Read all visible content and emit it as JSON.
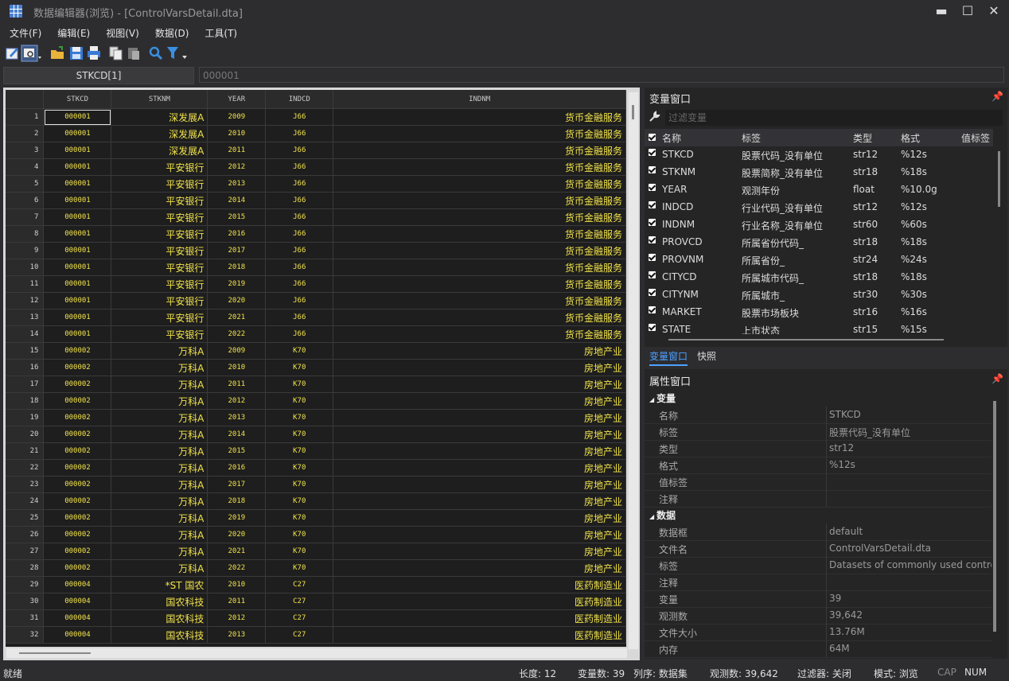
{
  "window": {
    "title": "数据编辑器(浏览) - [ControlVarsDetail.dta]",
    "min_glyph": "▬",
    "max_glyph": "☐",
    "close_glyph": "✕"
  },
  "menu": [
    "文件(F)",
    "编辑(E)",
    "视图(V)",
    "数据(D)",
    "工具(T)"
  ],
  "cellbar": {
    "name": "STKCD[1]",
    "value": "000001"
  },
  "grid": {
    "columns": [
      "STKCD",
      "STKNM",
      "YEAR",
      "INDCD",
      "INDNM"
    ],
    "rows": [
      [
        "1",
        "000001",
        "深发展A",
        "2009",
        "J66",
        "货币金融服务"
      ],
      [
        "2",
        "000001",
        "深发展A",
        "2010",
        "J66",
        "货币金融服务"
      ],
      [
        "3",
        "000001",
        "深发展A",
        "2011",
        "J66",
        "货币金融服务"
      ],
      [
        "4",
        "000001",
        "平安银行",
        "2012",
        "J66",
        "货币金融服务"
      ],
      [
        "5",
        "000001",
        "平安银行",
        "2013",
        "J66",
        "货币金融服务"
      ],
      [
        "6",
        "000001",
        "平安银行",
        "2014",
        "J66",
        "货币金融服务"
      ],
      [
        "7",
        "000001",
        "平安银行",
        "2015",
        "J66",
        "货币金融服务"
      ],
      [
        "8",
        "000001",
        "平安银行",
        "2016",
        "J66",
        "货币金融服务"
      ],
      [
        "9",
        "000001",
        "平安银行",
        "2017",
        "J66",
        "货币金融服务"
      ],
      [
        "10",
        "000001",
        "平安银行",
        "2018",
        "J66",
        "货币金融服务"
      ],
      [
        "11",
        "000001",
        "平安银行",
        "2019",
        "J66",
        "货币金融服务"
      ],
      [
        "12",
        "000001",
        "平安银行",
        "2020",
        "J66",
        "货币金融服务"
      ],
      [
        "13",
        "000001",
        "平安银行",
        "2021",
        "J66",
        "货币金融服务"
      ],
      [
        "14",
        "000001",
        "平安银行",
        "2022",
        "J66",
        "货币金融服务"
      ],
      [
        "15",
        "000002",
        "万科A",
        "2009",
        "K70",
        "房地产业"
      ],
      [
        "16",
        "000002",
        "万科A",
        "2010",
        "K70",
        "房地产业"
      ],
      [
        "17",
        "000002",
        "万科A",
        "2011",
        "K70",
        "房地产业"
      ],
      [
        "18",
        "000002",
        "万科A",
        "2012",
        "K70",
        "房地产业"
      ],
      [
        "19",
        "000002",
        "万科A",
        "2013",
        "K70",
        "房地产业"
      ],
      [
        "20",
        "000002",
        "万科A",
        "2014",
        "K70",
        "房地产业"
      ],
      [
        "21",
        "000002",
        "万科A",
        "2015",
        "K70",
        "房地产业"
      ],
      [
        "22",
        "000002",
        "万科A",
        "2016",
        "K70",
        "房地产业"
      ],
      [
        "23",
        "000002",
        "万科A",
        "2017",
        "K70",
        "房地产业"
      ],
      [
        "24",
        "000002",
        "万科A",
        "2018",
        "K70",
        "房地产业"
      ],
      [
        "25",
        "000002",
        "万科A",
        "2019",
        "K70",
        "房地产业"
      ],
      [
        "26",
        "000002",
        "万科A",
        "2020",
        "K70",
        "房地产业"
      ],
      [
        "27",
        "000002",
        "万科A",
        "2021",
        "K70",
        "房地产业"
      ],
      [
        "28",
        "000002",
        "万科A",
        "2022",
        "K70",
        "房地产业"
      ],
      [
        "29",
        "000004",
        "*ST 国农",
        "2010",
        "C27",
        "医药制造业"
      ],
      [
        "30",
        "000004",
        "国农科技",
        "2011",
        "C27",
        "医药制造业"
      ],
      [
        "31",
        "000004",
        "国农科技",
        "2012",
        "C27",
        "医药制造业"
      ],
      [
        "32",
        "000004",
        "国农科技",
        "2013",
        "C27",
        "医药制造业"
      ]
    ]
  },
  "variables_panel": {
    "title": "变量窗口",
    "filter_placeholder": "过滤变量",
    "headers": [
      "名称",
      "标签",
      "类型",
      "格式",
      "值标签"
    ],
    "rows": [
      [
        "STKCD",
        "股票代码_没有单位",
        "str12",
        "%12s"
      ],
      [
        "STKNM",
        "股票简称_没有单位",
        "str18",
        "%18s"
      ],
      [
        "YEAR",
        "观测年份",
        "float",
        "%10.0g"
      ],
      [
        "INDCD",
        "行业代码_没有单位",
        "str12",
        "%12s"
      ],
      [
        "INDNM",
        "行业名称_没有单位",
        "str60",
        "%60s"
      ],
      [
        "PROVCD",
        "所属省份代码_",
        "str18",
        "%18s"
      ],
      [
        "PROVNM",
        "所属省份_",
        "str24",
        "%24s"
      ],
      [
        "CITYCD",
        "所属城市代码_",
        "str18",
        "%18s"
      ],
      [
        "CITYNM",
        "所属城市_",
        "str30",
        "%30s"
      ],
      [
        "MARKET",
        "股票市场板块",
        "str16",
        "%16s"
      ],
      [
        "STATE",
        "上市状态",
        "str15",
        "%15s"
      ]
    ],
    "tabs": [
      "变量窗口",
      "快照"
    ]
  },
  "properties_panel": {
    "title": "属性窗口",
    "sections": [
      {
        "name": "变量",
        "rows": [
          [
            "名称",
            "STKCD"
          ],
          [
            "标签",
            "股票代码_没有单位"
          ],
          [
            "类型",
            "str12"
          ],
          [
            "格式",
            "%12s"
          ],
          [
            "值标签",
            ""
          ],
          [
            "注释",
            ""
          ]
        ]
      },
      {
        "name": "数据",
        "rows": [
          [
            "数据框",
            "default"
          ],
          [
            "文件名",
            "ControlVarsDetail.dta"
          ],
          [
            "标签",
            "Datasets of commonly used control variables"
          ],
          [
            "注释",
            ""
          ],
          [
            "变量",
            "39"
          ],
          [
            "观测数",
            "39,642"
          ],
          [
            "文件大小",
            "13.76M"
          ],
          [
            "内存",
            "64M"
          ]
        ]
      }
    ]
  },
  "status": {
    "ready": "就绪",
    "length": "长度: 12",
    "varcount": "变量数: 39",
    "order": "列序: 数据集",
    "obs": "观测数: 39,642",
    "filter": "过滤器: 关闭",
    "mode": "模式: 浏览",
    "cap": "CAP",
    "num": "NUM"
  }
}
